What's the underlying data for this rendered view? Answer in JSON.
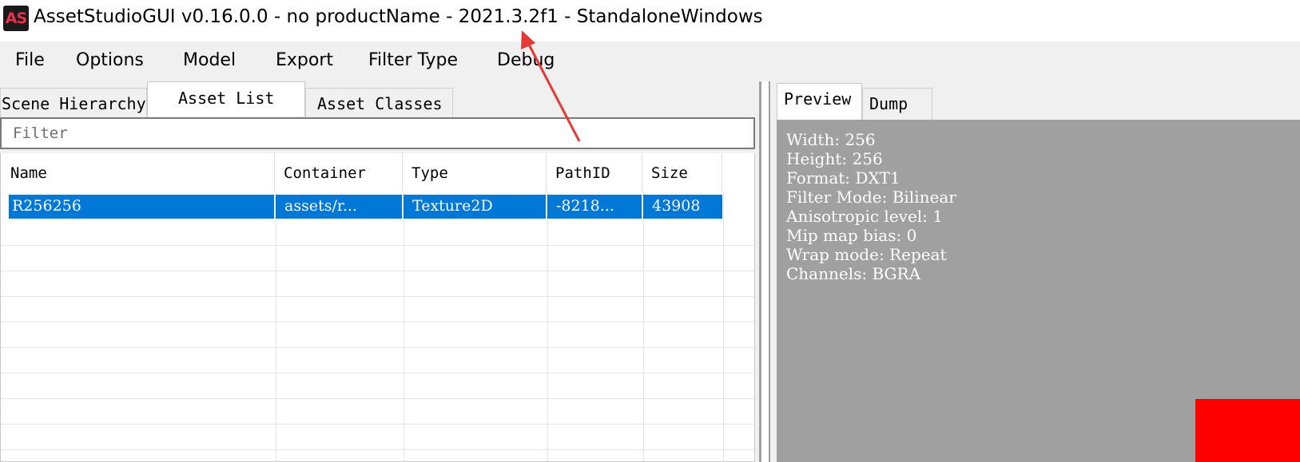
{
  "window": {
    "logo_text": "AS",
    "title": "AssetStudioGUI v0.16.0.0 - no productName - 2021.3.2f1 - StandaloneWindows"
  },
  "menu": [
    "File",
    "Options",
    "Model",
    "Export",
    "Filter Type",
    "Debug"
  ],
  "left_tabs": [
    "Scene Hierarchy",
    "Asset List",
    "Asset Classes"
  ],
  "active_left_tab": "Asset List",
  "filter": {
    "placeholder": "Filter",
    "value": ""
  },
  "columns": [
    "Name",
    "Container",
    "Type",
    "PathID",
    "Size"
  ],
  "rows": [
    {
      "name": "R256256",
      "container": "assets/r...",
      "type": "Texture2D",
      "path_id": "-8218...",
      "size": "43908",
      "selected": true
    }
  ],
  "right_tabs": [
    "Preview",
    "Dump"
  ],
  "active_right_tab": "Preview",
  "preview_info": [
    "Width: 256",
    "Height: 256",
    "Format: DXT1",
    "Filter Mode: Bilinear",
    "Anisotropic level: 1",
    "Mip map bias: 0",
    "Wrap mode: Repeat",
    "Channels: BGRA"
  ],
  "colors": {
    "selection": "#0078d7",
    "preview_background": "#a0a0a0",
    "texture_color": "#ff0000",
    "annotation_arrow": "#e53935"
  }
}
